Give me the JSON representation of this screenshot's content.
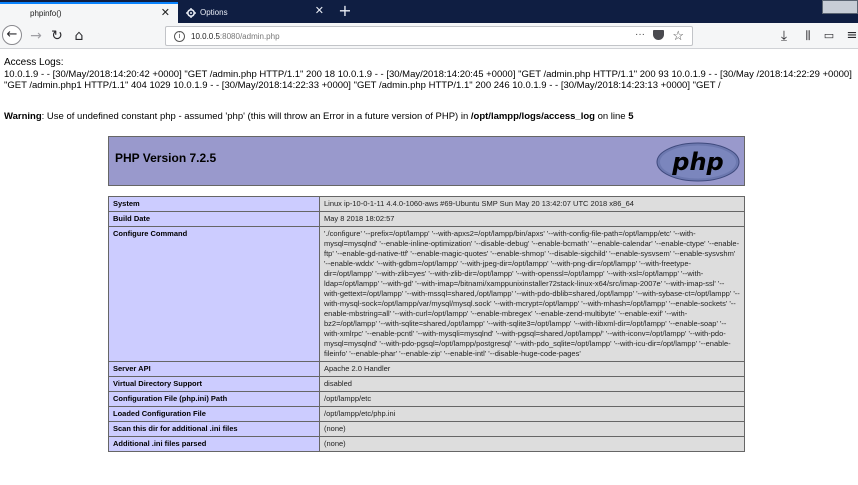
{
  "tabs": [
    {
      "label": "phpinfo()",
      "active": true
    },
    {
      "label": "Options",
      "active": false
    }
  ],
  "address_bar": {
    "host": "10.0.0.5",
    "rest": ":8080/admin.php"
  },
  "page": {
    "access_title": "Access Logs:",
    "log_text": "10.0.1.9 - - [30/May/2018:14:20:42 +0000] \"GET /admin.php HTTP/1.1\" 200 18 10.0.1.9 - - [30/May/2018:14:20:45 +0000] \"GET /admin.php HTTP/1.1\" 200 93 10.0.1.9 - - [30/May /2018:14:22:29 +0000] \"GET /admin.php1 HTTP/1.1\" 404 1029 10.0.1.9 - - [30/May/2018:14:22:33 +0000] \"GET /admin.php HTTP/1.1\" 200 246 10.0.1.9 - - [30/May/2018:14:23:13 +0000] \"GET /",
    "warning_label": "Warning",
    "warning_msg": ": Use of undefined constant php - assumed 'php' (this will throw an Error in a future version of PHP) in ",
    "warning_path": "/opt/lampp/logs/access_log",
    "warning_on_line": " on line ",
    "warning_line": "5"
  },
  "phpinfo": {
    "version": "PHP Version 7.2.5",
    "logo_text": "php",
    "rows": [
      {
        "key": "System",
        "value": "Linux ip-10-0-1-11 4.4.0-1060-aws #69-Ubuntu SMP Sun May 20 13:42:07 UTC 2018 x86_64"
      },
      {
        "key": "Build Date",
        "value": "May 8 2018 18:02:57"
      },
      {
        "key": "Configure Command",
        "value": "'./configure' '--prefix=/opt/lampp' '--with-apxs2=/opt/lampp/bin/apxs' '--with-config-file-path=/opt/lampp/etc' '--with-mysql=mysqlnd' '--enable-inline-optimization' '--disable-debug' '--enable-bcmath' '--enable-calendar' '--enable-ctype' '--enable-ftp' '--enable-gd-native-ttf' '--enable-magic-quotes' '--enable-shmop' '--disable-sigchild' '--enable-sysvsem' '--enable-sysvshm' '--enable-wddx' '--with-gdbm=/opt/lampp' '--with-jpeg-dir=/opt/lampp' '--with-png-dir=/opt/lampp' '--with-freetype-dir=/opt/lampp' '--with-zlib=yes' '--with-zlib-dir=/opt/lampp' '--with-openssl=/opt/lampp' '--with-xsl=/opt/lampp' '--with-ldap=/opt/lampp' '--with-gd' '--with-imap=/bitnami/xamppunixinstaller72stack-linux-x64/src/imap-2007e' '--with-imap-ssl' '--with-gettext=/opt/lampp' '--with-mssql=shared,/opt/lampp' '--with-pdo-dblib=shared,/opt/lampp' '--with-sybase-ct=/opt/lampp' '--with-mysql-sock=/opt/lampp/var/mysql/mysql.sock' '--with-mcrypt=/opt/lampp' '--with-mhash=/opt/lampp' '--enable-sockets' '--enable-mbstring=all' '--with-curl=/opt/lampp' '--enable-mbregex' '--enable-zend-multibyte' '--enable-exif' '--with-bz2=/opt/lampp' '--with-sqlite=shared,/opt/lampp' '--with-sqlite3=/opt/lampp' '--with-libxml-dir=/opt/lampp' '--enable-soap' '--with-xmlrpc' '--enable-pcntl' '--with-mysqli=mysqlnd' '--with-pgsql=shared,/opt/lampp/' '--with-iconv=/opt/lampp' '--with-pdo-mysql=mysqlnd' '--with-pdo-pgsql=/opt/lampp/postgresql' '--with-pdo_sqlite=/opt/lampp' '--with-icu-dir=/opt/lampp' '--enable-fileinfo' '--enable-phar' '--enable-zip' '--enable-intl' '--disable-huge-code-pages'"
      },
      {
        "key": "Server API",
        "value": "Apache 2.0 Handler"
      },
      {
        "key": "Virtual Directory Support",
        "value": "disabled"
      },
      {
        "key": "Configuration File (php.ini) Path",
        "value": "/opt/lampp/etc"
      },
      {
        "key": "Loaded Configuration File",
        "value": "/opt/lampp/etc/php.ini"
      },
      {
        "key": "Scan this dir for additional .ini files",
        "value": "(none)"
      },
      {
        "key": "Additional .ini files parsed",
        "value": "(none)"
      }
    ]
  }
}
